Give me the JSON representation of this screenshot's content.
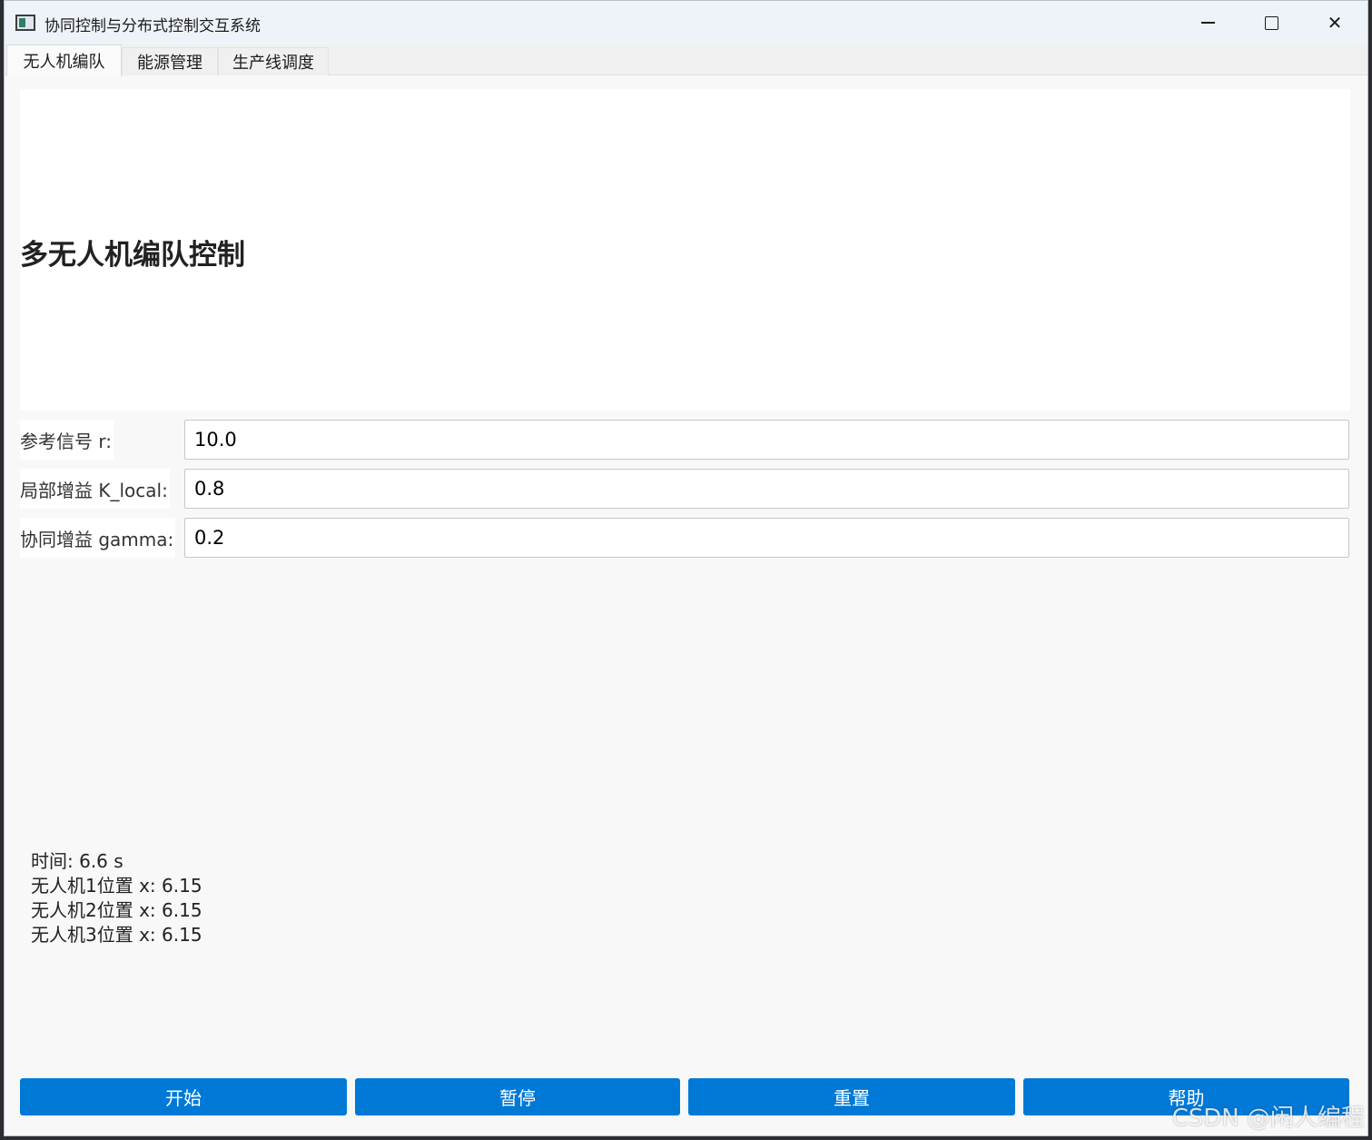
{
  "window": {
    "title": "协同控制与分布式控制交互系统",
    "controls": {
      "minimize": "minimize-icon",
      "maximize": "maximize-icon",
      "close": "close-icon"
    }
  },
  "tabs": [
    {
      "label": "无人机编队",
      "active": true
    },
    {
      "label": "能源管理",
      "active": false
    },
    {
      "label": "生产线调度",
      "active": false
    }
  ],
  "header": {
    "title": "多无人机编队控制"
  },
  "params": [
    {
      "label": "参考信号 r:",
      "value": "10.0"
    },
    {
      "label": "局部增益 K_local:",
      "value": "0.8"
    },
    {
      "label": "协同增益 gamma:",
      "value": "0.2"
    }
  ],
  "status": {
    "time": "时间: 6.6 s",
    "drone1": "无人机1位置 x: 6.15",
    "drone2": "无人机2位置 x: 6.15",
    "drone3": "无人机3位置 x: 6.15"
  },
  "buttons": {
    "start": "开始",
    "pause": "暂停",
    "reset": "重置",
    "help": "帮助"
  },
  "watermark": "CSDN @闲人编程",
  "colors": {
    "accent": "#0079d6",
    "background": "#f8f8f8",
    "panel": "#ffffff"
  }
}
